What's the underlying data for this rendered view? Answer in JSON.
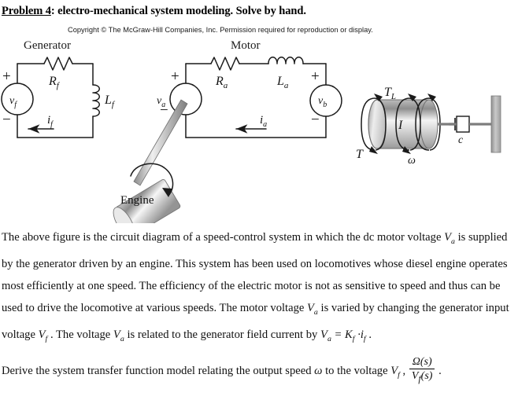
{
  "header": {
    "problem_label": "Problem 4",
    "title_rest": ": electro-mechanical system modeling. Solve by hand.",
    "copyright": "Copyright © The McGraw-Hill Companies, Inc. Permission required for reproduction or display."
  },
  "figure": {
    "section_labels": {
      "generator": "Generator",
      "motor": "Motor"
    },
    "generator": {
      "source_label": "v",
      "source_sub": "f",
      "plus": "+",
      "minus": "−",
      "resistor_label": "R",
      "resistor_sub": "f",
      "inductor_label": "L",
      "inductor_sub": "f",
      "current_label": "i",
      "current_sub": "f"
    },
    "engine": {
      "label": "Engine"
    },
    "motor": {
      "source_a_label": "v",
      "source_a_sub": "a",
      "plus_a": "+",
      "minus_a": "−",
      "resistor_label": "R",
      "resistor_sub": "a",
      "inductor_label": "L",
      "inductor_sub": "a",
      "current_label": "i",
      "current_sub": "a",
      "backemf_label": "v",
      "backemf_sub": "b",
      "plus_b": "+",
      "minus_b": "−"
    },
    "load": {
      "inertia_label": "I",
      "torque_label": "T",
      "load_torque_label": "T",
      "load_torque_sub": "L",
      "speed_label": "ω",
      "damper_label": "c"
    }
  },
  "body": {
    "paragraph1_part1": "The above figure is the circuit diagram of a speed-control system in which the dc motor voltage ",
    "va_1_main": "V",
    "va_1_sub": "a",
    "paragraph1_part2": " is supplied by the generator driven by an engine. This system has been used on locomotives whose diesel engine operates most efficiently at one speed. The efficiency of the electric motor is not as sensitive to speed and thus can be used to drive the locomotive at various speeds. The motor voltage ",
    "va_2_main": "V",
    "va_2_sub": "a",
    "paragraph1_part3": " is varied by changing the generator input voltage ",
    "vf_1_main": "V",
    "vf_1_sub": "f",
    "paragraph1_part4": " . The voltage ",
    "va_3_main": "V",
    "va_3_sub": "a",
    "paragraph1_part5": " is related to the generator field current by ",
    "eq_va_main": "V",
    "eq_va_sub": "a",
    "eq_equals": " = ",
    "eq_k_main": "K",
    "eq_k_sub": "f",
    "eq_dot": " ·",
    "eq_i_main": "i",
    "eq_i_sub": "f",
    "paragraph1_part6": " .",
    "paragraph2_part1": "Derive the system transfer function model relating the output speed ",
    "omega": "ω",
    "paragraph2_part2": " to the voltage ",
    "vf_2_main": "V",
    "vf_2_sub": "f",
    "paragraph2_comma": " , ",
    "fraction_numerator": "Ω(s)",
    "fraction_denominator_main": "V",
    "fraction_denominator_sub": "f",
    "fraction_denominator_tail": "(s)",
    "paragraph2_end": " ."
  },
  "colors": {
    "wire": "#1a1a1a",
    "metal_light": "#f2f2f2",
    "metal_mid": "#b8b8b8",
    "metal_dark": "#8f8f8f",
    "wall": "#a8a8a8"
  }
}
